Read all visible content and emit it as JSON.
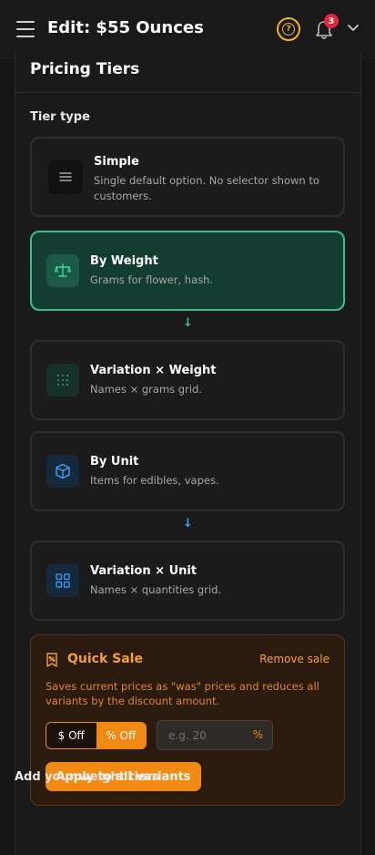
{
  "header": {
    "title": "Edit: $55 Ounces",
    "notification_count": "3"
  },
  "panel": {
    "title": "Pricing Tiers",
    "tier_type_label": "Tier type",
    "tiers": [
      {
        "name": "Simple",
        "desc": "Single default option. No selector shown to customers.",
        "icon": "lines-icon",
        "selected": false
      },
      {
        "name": "By Weight",
        "desc": "Grams for flower, hash.",
        "icon": "scale-icon",
        "selected": true
      },
      {
        "name": "Variation × Weight",
        "desc": "Names × grams grid.",
        "icon": "dot-grid-icon",
        "selected": false
      },
      {
        "name": "By Unit",
        "desc": "Items for edibles, vapes.",
        "icon": "box-icon",
        "selected": false
      },
      {
        "name": "Variation × Unit",
        "desc": "Names × quantities grid.",
        "icon": "four-squares-icon",
        "selected": false
      }
    ],
    "arrow_glyph": "↓"
  },
  "quick_sale": {
    "title": "Quick Sale",
    "remove_label": "Remove sale",
    "description": "Saves current prices as \"was\" prices and reduces all variants by the discount amount.",
    "mode_dollar": "$ Off",
    "mode_percent": "% Off",
    "active_mode": "% Off",
    "amount_placeholder": "e.g. 20",
    "amount_value": "",
    "amount_unit": "%",
    "apply_label": "Apply to all variants"
  },
  "footer_label": "Add your weight tiers",
  "colors": {
    "accent_green": "#2ec290",
    "accent_blue": "#3aa3ff",
    "accent_orange": "#f08a12",
    "warning_yellow": "#f2b518",
    "badge_red": "#e5253f"
  }
}
